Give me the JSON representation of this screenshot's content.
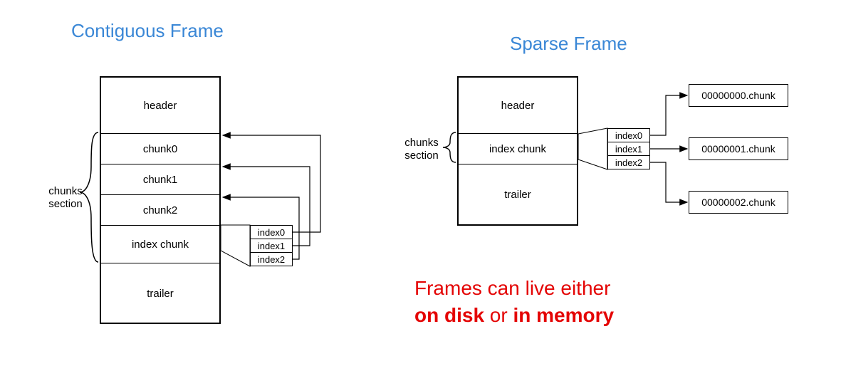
{
  "titles": {
    "contiguous": "Contiguous Frame",
    "sparse": "Sparse Frame"
  },
  "labels": {
    "chunks_section_line1": "chunks",
    "chunks_section_line2": "section"
  },
  "contiguous": {
    "header": "header",
    "chunk0": "chunk0",
    "chunk1": "chunk1",
    "chunk2": "chunk2",
    "index_chunk": "index chunk",
    "trailer": "trailer",
    "index0": "index0",
    "index1": "index1",
    "index2": "index2"
  },
  "sparse": {
    "header": "header",
    "index_chunk": "index chunk",
    "trailer": "trailer",
    "index0": "index0",
    "index1": "index1",
    "index2": "index2",
    "file0": "00000000.chunk",
    "file1": "00000001.chunk",
    "file2": "00000002.chunk"
  },
  "caption": {
    "line1_a": "Frames can live either",
    "line2_a": "on disk",
    "line2_b": " or ",
    "line2_c": "in memory"
  },
  "colors": {
    "title_blue": "#3a87d6",
    "caption_red": "#e40404"
  }
}
